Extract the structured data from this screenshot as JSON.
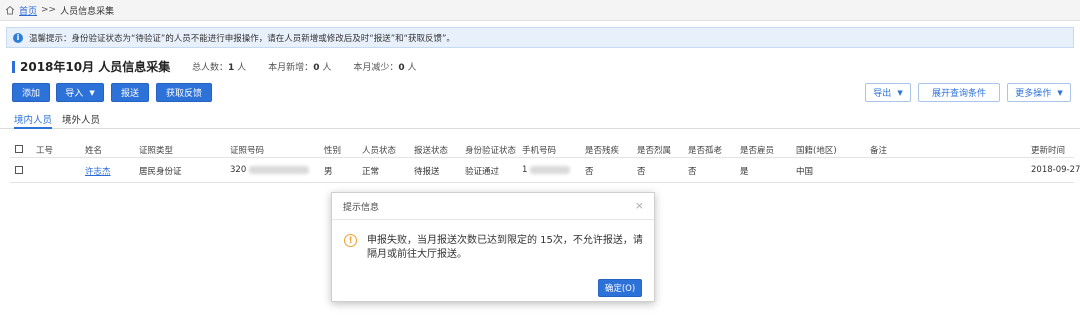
{
  "breadcrumb": {
    "home": "首页",
    "separator": ">>",
    "current": "人员信息采集"
  },
  "notice": {
    "text": "温馨提示：身份验证状态为“待验证”的人员不能进行申报操作，请在人员新增或修改后及时“报送”和“获取反馈”。"
  },
  "page": {
    "title": "2018年10月  人员信息采集",
    "stats": [
      {
        "label": "总人数：",
        "value": "1",
        "unit": "人"
      },
      {
        "label": "本月新增：",
        "value": "0",
        "unit": "人"
      },
      {
        "label": "本月减少：",
        "value": "0",
        "unit": "人"
      }
    ]
  },
  "toolbar": {
    "add": "添加",
    "import": "导入",
    "submit": "报送",
    "feedback": "获取反馈",
    "export": "导出",
    "expand_query": "展开查询条件",
    "more": "更多操作"
  },
  "tabs": {
    "domestic": "境内人员",
    "overseas": "境外人员"
  },
  "table": {
    "headers": {
      "id": "工号",
      "name": "姓名",
      "id_type": "证照类型",
      "id_no": "证照号码",
      "gender": "性别",
      "status": "人员状态",
      "submit_status": "报送状态",
      "verify_status": "身份验证状态",
      "phone": "手机号码",
      "disabled": "是否残疾",
      "martyr": "是否烈属",
      "elderly": "是否孤老",
      "employee": "是否雇员",
      "nationality": "国籍(地区)",
      "remark": "备注",
      "updated": "更新时间"
    },
    "rows": [
      {
        "id": "",
        "name": "许志杰",
        "id_type": "居民身份证",
        "id_no_prefix": "320",
        "gender": "男",
        "status": "正常",
        "submit_status": "待报送",
        "verify_status": "验证通过",
        "phone_prefix": "1",
        "disabled": "否",
        "martyr": "否",
        "elderly": "否",
        "employee": "是",
        "nationality": "中国",
        "remark": "",
        "updated": "2018-09-27"
      }
    ]
  },
  "modal": {
    "title": "提示信息",
    "close": "×",
    "message": "申报失败，当月报送次数已达到限定的 15次，不允许报送，请隔月或前往大厅报送。",
    "ok": "确定(O)"
  }
}
